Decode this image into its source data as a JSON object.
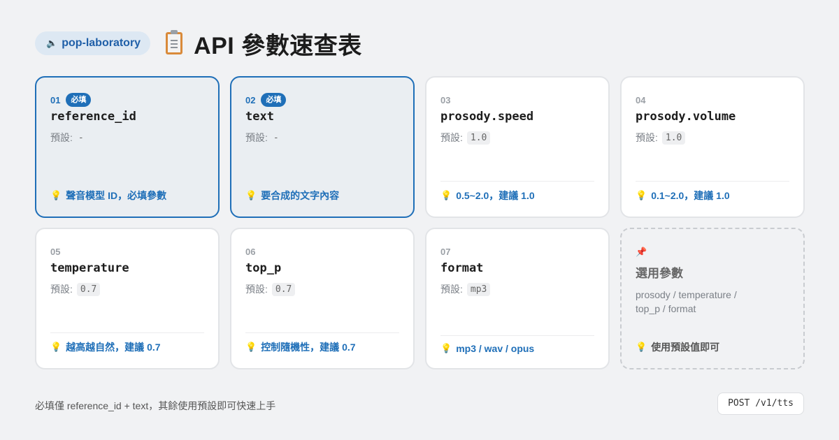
{
  "header": {
    "brand": "pop-laboratory",
    "brand_icon": "speaker-icon",
    "title_icon": "clipboard-icon",
    "title": "API 參數速查表"
  },
  "default_label": "預設:",
  "params": [
    {
      "num": "01",
      "badge": "必填",
      "name": "reference_id",
      "default": "-",
      "tip": "聲音模型 ID，必填參數"
    },
    {
      "num": "02",
      "badge": "必填",
      "name": "text",
      "default": "-",
      "tip": "要合成的文字內容"
    },
    {
      "num": "03",
      "name": "prosody.speed",
      "default": "1.0",
      "tip": "0.5~2.0，建議 1.0"
    },
    {
      "num": "04",
      "name": "prosody.volume",
      "default": "1.0",
      "tip": "0.1~2.0，建議 1.0"
    },
    {
      "num": "05",
      "name": "temperature",
      "default": "0.7",
      "tip": "越高越自然，建議 0.7"
    },
    {
      "num": "06",
      "name": "top_p",
      "default": "0.7",
      "tip": "控制隨機性，建議 0.7"
    },
    {
      "num": "07",
      "name": "format",
      "default": "mp3",
      "tip": "mp3 / wav / opus"
    }
  ],
  "optional_card": {
    "icon": "pin-icon",
    "title": "選用參數",
    "desc_line1": "prosody / temperature /",
    "desc_line2": "top_p / format",
    "tip": "使用預設值即可"
  },
  "footer": {
    "note": "必填僅 reference_id + text，其餘使用預設即可快速上手",
    "endpoint": "POST /v1/tts"
  },
  "colors": {
    "accent": "#1f6fb8",
    "required_bg": "#eaeef2",
    "page_bg": "#f1f2f4"
  }
}
